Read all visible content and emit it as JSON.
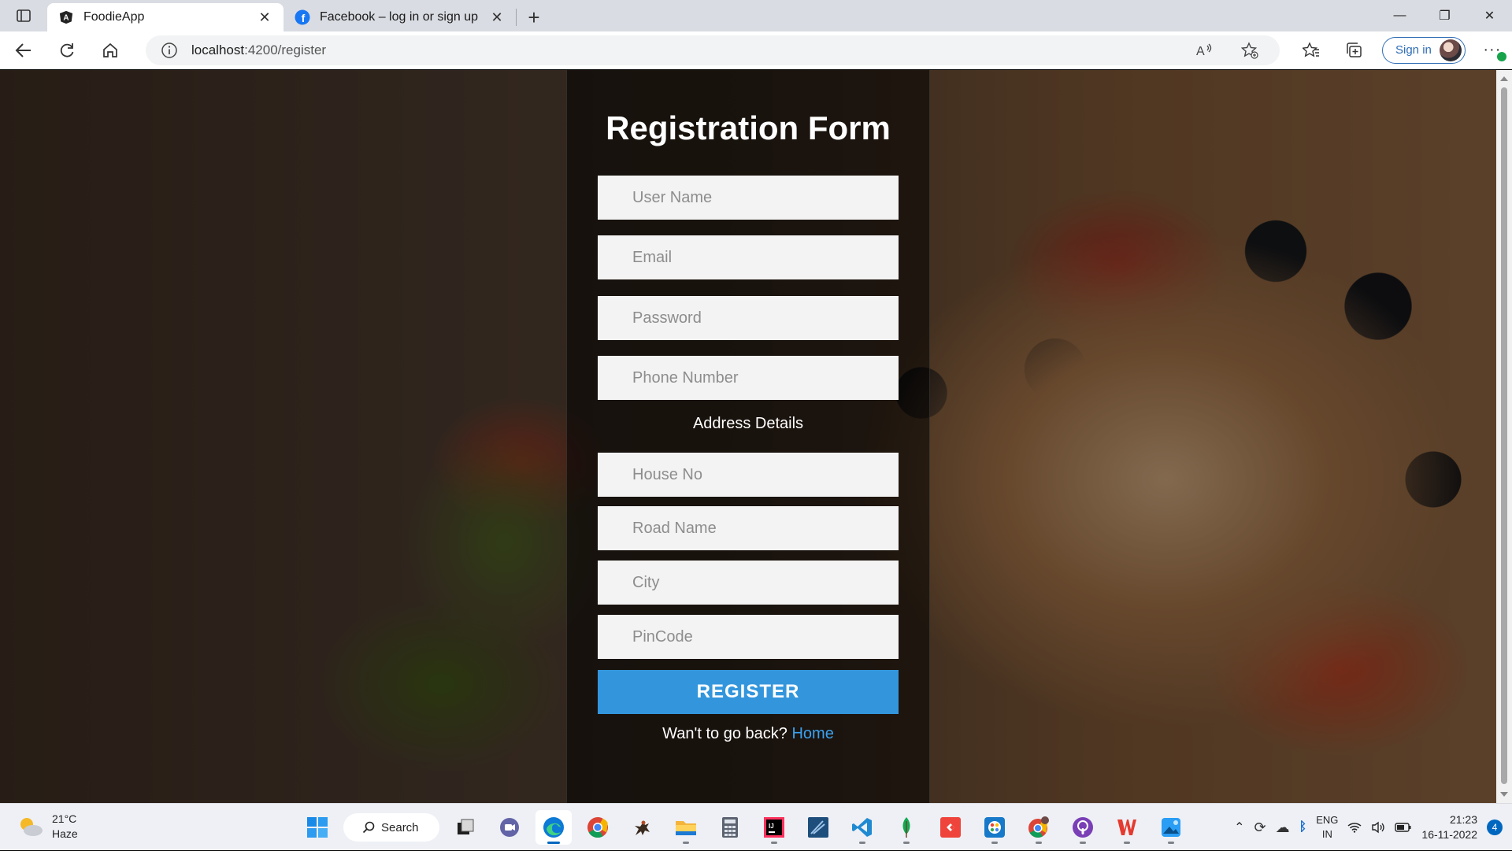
{
  "browser": {
    "tabs": [
      {
        "title": "FoodieApp",
        "active": true,
        "icon": "angular-icon"
      },
      {
        "title": "Facebook – log in or sign up",
        "active": false,
        "icon": "facebook-icon"
      }
    ],
    "url_host": "localhost",
    "url_rest": ":4200/register",
    "signin_label": "Sign in"
  },
  "form": {
    "title": "Registration Form",
    "fields": {
      "username": "User Name",
      "email": "Email",
      "password": "Password",
      "phone": "Phone Number",
      "house": "House No",
      "road": "Road Name",
      "city": "City",
      "pincode": "PinCode"
    },
    "address_label": "Address Details",
    "register_label": "REGISTER",
    "back_text": "Wan't to go back?",
    "home_link": "Home"
  },
  "taskbar": {
    "temperature": "21°C",
    "condition": "Haze",
    "search_label": "Search",
    "lang_line1": "ENG",
    "lang_line2": "IN",
    "time": "21:23",
    "date": "16-11-2022",
    "notification_count": "4"
  },
  "colors": {
    "accent": "#3396dc",
    "link": "#3aa2f0",
    "edge_blue": "#0067c0"
  }
}
